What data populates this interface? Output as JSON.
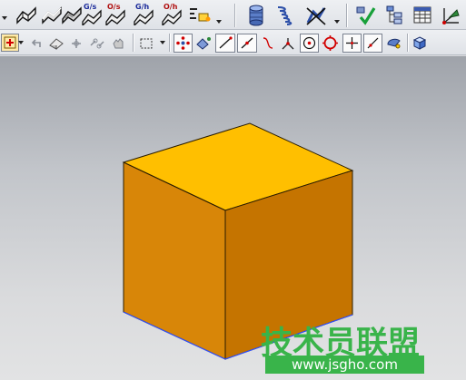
{
  "toolbar_top": {
    "buttons": [
      {
        "icon": "surface-icon"
      },
      {
        "icon": "shaded-surface-icon"
      },
      {
        "icon": "shaded-surface-icon"
      },
      {
        "icon": "surface-gs-icon",
        "label": "G/s"
      },
      {
        "icon": "surface-os-icon",
        "label": "O/s"
      },
      {
        "icon": "surface-gh-icon",
        "label": "G/h"
      },
      {
        "icon": "surface-oh-icon",
        "label": "O/h"
      },
      {
        "icon": "display-options-icon"
      },
      {
        "icon": "cylinder-icon"
      },
      {
        "icon": "spring-icon"
      },
      {
        "icon": "no-wireframe-icon"
      },
      {
        "icon": "check-icon"
      },
      {
        "icon": "tree-icon"
      },
      {
        "icon": "table-icon"
      },
      {
        "icon": "axis-icon"
      }
    ]
  },
  "toolbar_bottom": {
    "buttons": [
      {
        "icon": "new-part-icon"
      },
      {
        "icon": "undo-icon"
      },
      {
        "icon": "eraser-icon"
      },
      {
        "icon": "transform-icon"
      },
      {
        "icon": "move-icon"
      },
      {
        "icon": "hand-icon"
      },
      {
        "icon": "select-box-icon"
      },
      {
        "icon": "snap-points-icon"
      },
      {
        "icon": "snap-move-icon"
      },
      {
        "icon": "line-icon"
      },
      {
        "icon": "line-point-icon"
      },
      {
        "icon": "curve-icon"
      },
      {
        "icon": "branch-icon"
      },
      {
        "icon": "circle-point-icon"
      },
      {
        "icon": "circle-target-icon"
      },
      {
        "icon": "cross-icon"
      },
      {
        "icon": "line-dot-icon"
      },
      {
        "icon": "sweep-icon"
      },
      {
        "icon": "cube-icon"
      }
    ]
  },
  "viewport": {
    "background_top": "#9fa3aa",
    "background_bottom": "#e2e3e4",
    "cube": {
      "top_color": "#ffbf00",
      "left_color": "#d88608",
      "right_color": "#c57400",
      "edge_color": "#2a1c00",
      "highlight_edge_color": "#3050ff"
    }
  },
  "watermark": {
    "text": "技术员联盟",
    "url": "www.jsgho.com",
    "color": "#39b44a"
  }
}
